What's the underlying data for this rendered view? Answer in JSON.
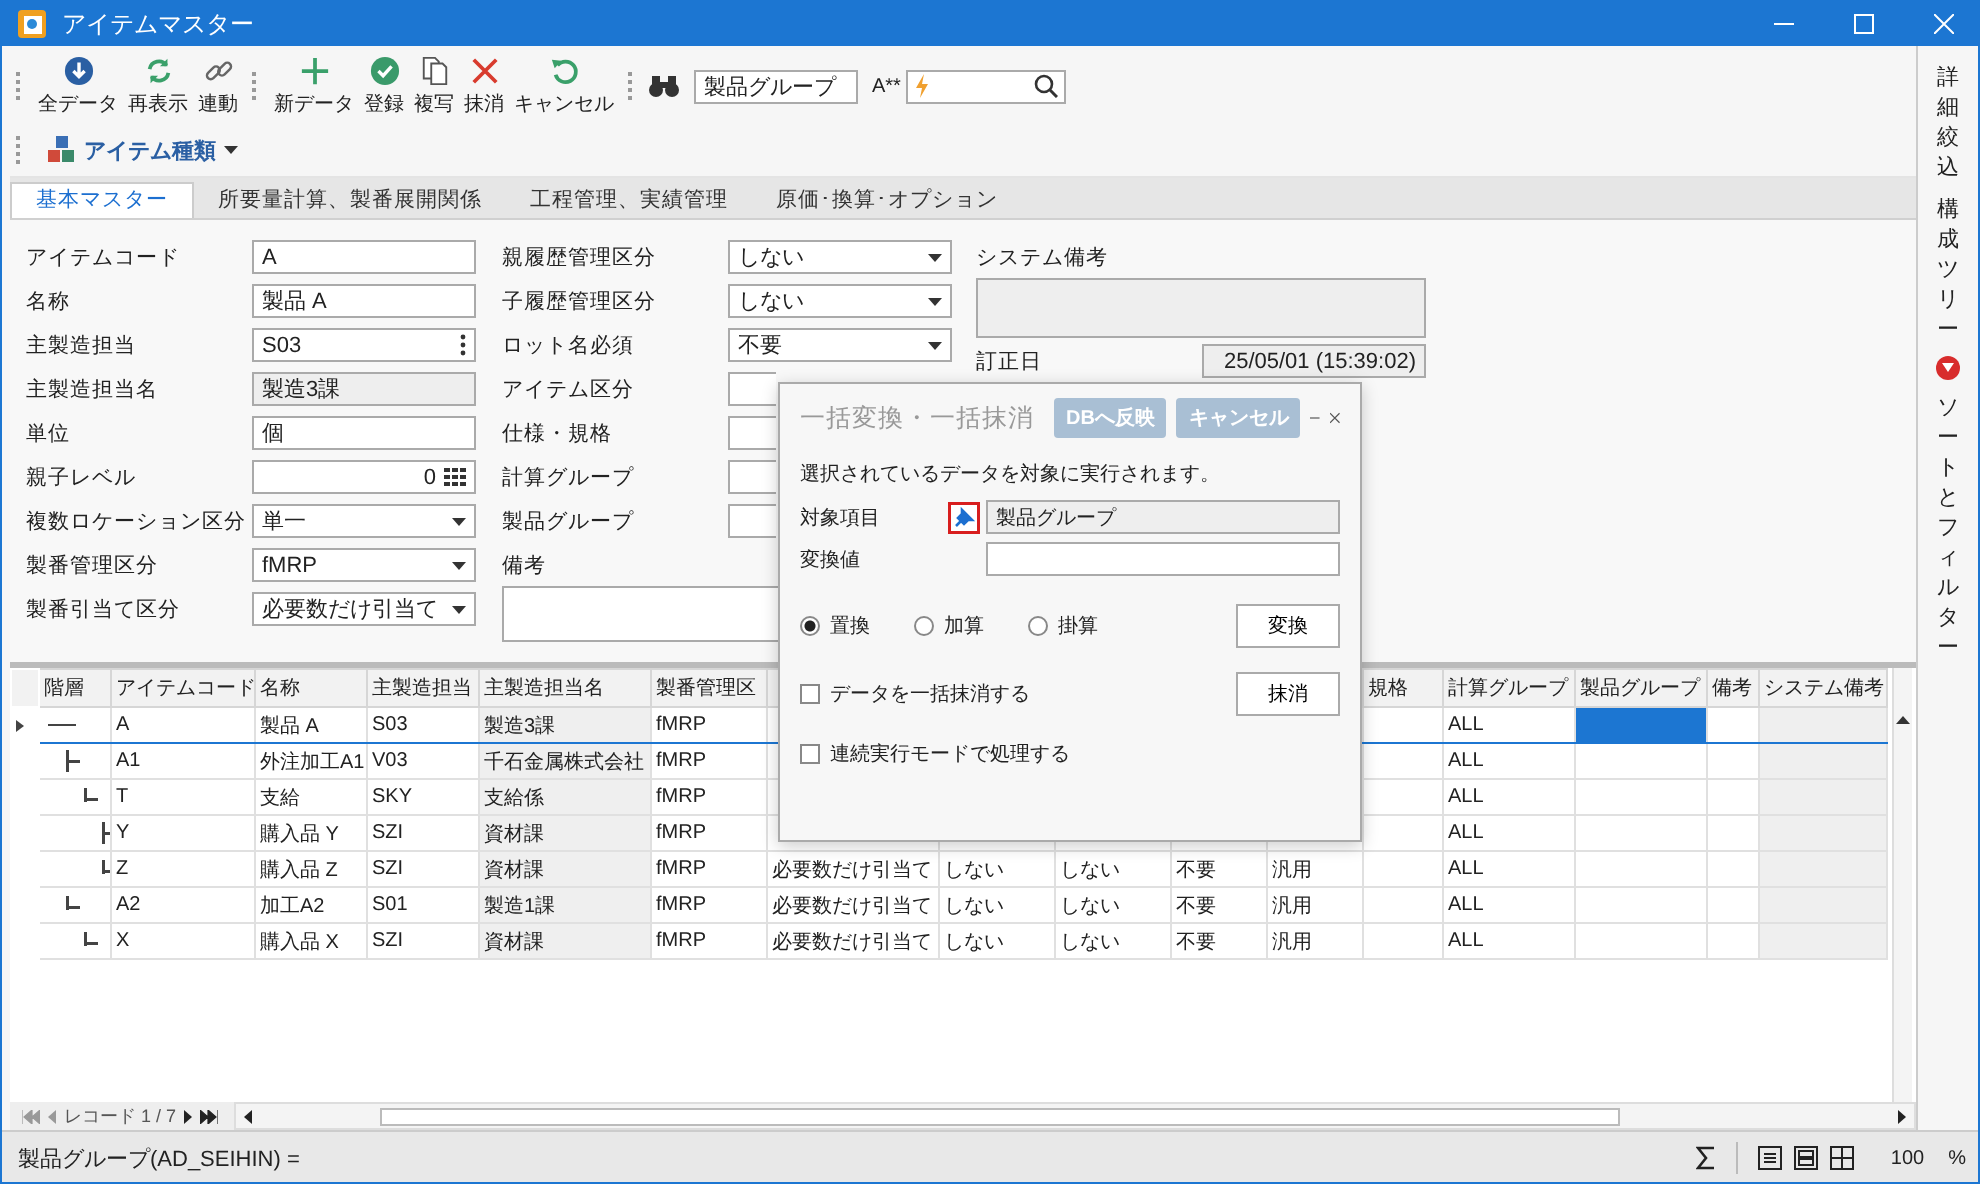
{
  "window": {
    "title": "アイテムマスター"
  },
  "toolbar": {
    "groups": [
      [
        {
          "label": "全データ",
          "kind": "download"
        },
        {
          "label": "再表示",
          "kind": "refresh"
        },
        {
          "label": "連動",
          "kind": "link"
        }
      ],
      [
        {
          "label": "新データ",
          "kind": "add"
        },
        {
          "label": "登録",
          "kind": "save"
        },
        {
          "label": "複写",
          "kind": "copy"
        },
        {
          "label": "抹消",
          "kind": "delete"
        },
        {
          "label": "キャンセル",
          "kind": "undo"
        }
      ]
    ],
    "field_selector": {
      "value": "製品グループ"
    },
    "match_label": "A**",
    "item_type_menu": {
      "label": "アイテム種類"
    }
  },
  "tabs": [
    {
      "label": "基本マスター",
      "selected": true
    },
    {
      "label": "所要量計算、製番展開関係",
      "selected": false
    },
    {
      "label": "工程管理、実績管理",
      "selected": false
    },
    {
      "label": "原価･換算･オプション",
      "selected": false
    }
  ],
  "form": {
    "columns": [
      [
        {
          "label": "アイテムコード",
          "kind": "text",
          "value": "A"
        },
        {
          "label": "名称",
          "kind": "text",
          "value": "製品 A"
        },
        {
          "label": "主製造担当",
          "kind": "picker",
          "value": "S03"
        },
        {
          "label": "主製造担当名",
          "kind": "readonly",
          "value": "製造3課"
        },
        {
          "label": "単位",
          "kind": "text",
          "value": "個"
        },
        {
          "label": "親子レベル",
          "kind": "number",
          "value": "0"
        },
        {
          "label": "複数ロケーション区分",
          "kind": "select",
          "value": "単一"
        },
        {
          "label": "製番管理区分",
          "kind": "select",
          "value": "fMRP"
        },
        {
          "label": "製番引当て区分",
          "kind": "select",
          "value": "必要数だけ引当て"
        }
      ],
      [
        {
          "label": "親履歴管理区分",
          "kind": "select",
          "value": "しない"
        },
        {
          "label": "子履歴管理区分",
          "kind": "select",
          "value": "しない"
        },
        {
          "label": "ロット名必須",
          "kind": "select",
          "value": "不要"
        },
        {
          "label": "アイテム区分",
          "kind": "select"
        },
        {
          "label": "仕様・規格",
          "kind": "text"
        },
        {
          "label": "計算グループ",
          "kind": "select"
        },
        {
          "label": "製品グループ",
          "kind": "select"
        },
        {
          "label": "備考",
          "kind": "memo"
        }
      ],
      [
        {
          "label": "システム備考",
          "kind": "readonly_memo"
        },
        {
          "label": "訂正日",
          "kind": "date",
          "value": "25/05/01 (15:39:02)"
        }
      ]
    ]
  },
  "grid": {
    "columns": [
      {
        "label": "階層"
      },
      {
        "label": "アイテムコード",
        "readonly": false
      },
      {
        "label": "名称",
        "readonly": false
      },
      {
        "label": "主製造担当",
        "readonly": false
      },
      {
        "label": "主製造担当名",
        "readonly": true
      },
      {
        "label": "製番管理区",
        "readonly": false
      },
      {},
      {},
      {},
      {},
      {},
      {
        "label": "規格",
        "readonly": false
      },
      {
        "label": "計算グループ",
        "readonly": false
      },
      {
        "label": "製品グループ",
        "readonly": false,
        "focused": true
      },
      {
        "label": "備考",
        "readonly": false
      },
      {
        "label": "システム備考",
        "readonly": true
      }
    ],
    "rows": [
      {
        "selected": true,
        "cells": [
          "",
          "A",
          "製品 A",
          "S03",
          "製造3課",
          "fMRP",
          null,
          null,
          null,
          null,
          null,
          null,
          "ALL",
          null,
          null,
          null
        ],
        "children": [
          {
            "selected": false,
            "cells": [
              "",
              "A1",
              "外注加工A1",
              "V03",
              "千石金属株式会社",
              "fMRP",
              null,
              null,
              null,
              null,
              null,
              null,
              "ALL",
              null,
              null,
              null
            ],
            "children": [
              {
                "selected": false,
                "cells": [
                  "",
                  "T",
                  "支給",
                  "SKY",
                  "支給係",
                  "fMRP",
                  null,
                  null,
                  null,
                  null,
                  null,
                  null,
                  "ALL",
                  null,
                  null,
                  null
                ],
                "children": [
                  {
                    "selected": false,
                    "cells": [
                      "",
                      "Y",
                      "購入品 Y",
                      "SZI",
                      "資材課",
                      "fMRP",
                      null,
                      null,
                      null,
                      null,
                      null,
                      null,
                      "ALL",
                      null,
                      null,
                      null
                    ]
                  },
                  {
                    "selected": false,
                    "cells": [
                      "",
                      "Z",
                      "購入品 Z",
                      "SZI",
                      "資材課",
                      "fMRP",
                      "必要数だけ引当て",
                      "しない",
                      "しない",
                      "不要",
                      "汎用",
                      null,
                      "ALL",
                      null,
                      null,
                      null
                    ]
                  }
                ]
              }
            ]
          },
          {
            "selected": false,
            "cells": [
              "",
              "A2",
              "加工A2",
              "S01",
              "製造1課",
              "fMRP",
              "必要数だけ引当て",
              "しない",
              "しない",
              "不要",
              "汎用",
              null,
              "ALL",
              null,
              null,
              null
            ],
            "children": [
              {
                "selected": false,
                "cells": [
                  "",
                  "X",
                  "購入品 X",
                  "SZI",
                  "資材課",
                  "fMRP",
                  "必要数だけ引当て",
                  "しない",
                  "しない",
                  "不要",
                  "汎用",
                  null,
                  "ALL",
                  null,
                  null,
                  null
                ]
              }
            ]
          }
        ]
      }
    ],
    "record_label": "レコード 1 / 7"
  },
  "side_tabs": [
    {
      "label": "詳細絞込",
      "badge": false
    },
    {
      "label": "構成ツリー",
      "badge": false
    },
    {
      "label": "ソートとフィルター",
      "badge": true
    }
  ],
  "status_bar": {
    "expression": "製品グループ(AD_SEIHIN) =",
    "zoom": "100",
    "unit": "%"
  },
  "dialog": {
    "title": "一括変換・一括抹消",
    "buttons": [
      {
        "label": "DBへ反映",
        "disabled": true
      },
      {
        "label": "キャンセル",
        "disabled": true
      }
    ],
    "message": "選択されているデータを対象に実行されます。",
    "target": {
      "label": "対象項目",
      "value": "製品グループ"
    },
    "new_value": {
      "label": "変換値"
    },
    "operations": [
      {
        "label": "置換",
        "selected": true
      },
      {
        "label": "加算",
        "selected": false
      },
      {
        "label": "掛算",
        "selected": false
      }
    ],
    "convert_button": "変換",
    "options": [
      {
        "label": "データを一括抹消する",
        "checked": false
      },
      {
        "label": "連続実行モードで処理する",
        "checked": false
      }
    ],
    "delete_button": "抹消"
  }
}
